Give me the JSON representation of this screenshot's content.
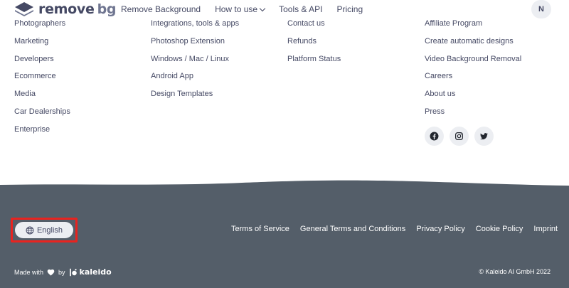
{
  "header": {
    "logo": {
      "text_main": "remove",
      "text_bg": "bg"
    },
    "nav": [
      {
        "label": "Remove Background",
        "dropdown": false
      },
      {
        "label": "How to use",
        "dropdown": true
      },
      {
        "label": "Tools & API",
        "dropdown": false
      },
      {
        "label": "Pricing",
        "dropdown": false
      }
    ],
    "avatar_initial": "N"
  },
  "columns": {
    "col1": [
      "Photographers",
      "Marketing",
      "Developers",
      "Ecommerce",
      "Media",
      "Car Dealerships",
      "Enterprise"
    ],
    "col2": [
      "Integrations, tools & apps",
      "Photoshop Extension",
      "Windows / Mac / Linux",
      "Android App",
      "Design Templates"
    ],
    "col3": [
      "Contact us",
      "Refunds",
      "Platform Status"
    ],
    "col4": [
      "Affiliate Program",
      "Create automatic designs",
      "Video Background Removal",
      "Careers",
      "About us",
      "Press"
    ]
  },
  "socials": [
    "facebook-icon",
    "instagram-icon",
    "twitter-icon"
  ],
  "footer": {
    "language_label": "English",
    "legal_links": [
      "Terms of Service",
      "General Terms and Conditions",
      "Privacy Policy",
      "Cookie Policy",
      "Imprint"
    ],
    "made_with": "Made with",
    "by": "by",
    "brand": "kaleido",
    "copyright": "© Kaleido AI GmbH 2022"
  },
  "colors": {
    "text": "#454964",
    "footer_bg": "#545e69",
    "highlight": "#e8231f",
    "chip_bg": "#eceef2"
  }
}
